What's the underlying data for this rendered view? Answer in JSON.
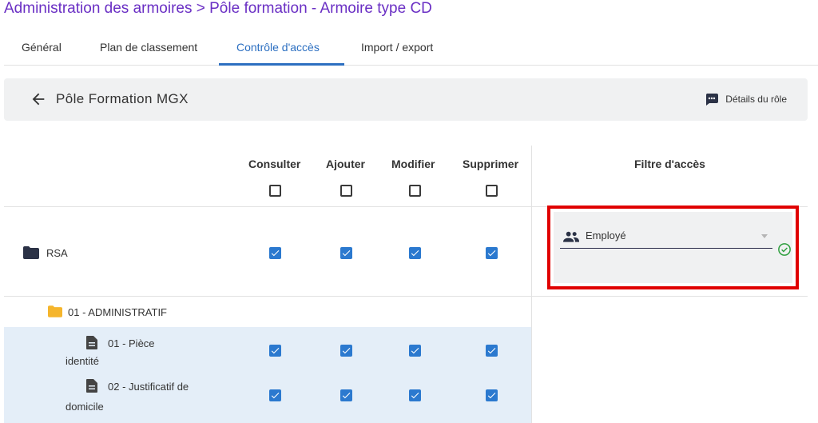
{
  "page": {
    "title": "Administration des armoires > Pôle formation - Armoire type CD"
  },
  "tabs": [
    {
      "label": "Général",
      "active": false
    },
    {
      "label": "Plan de classement",
      "active": false
    },
    {
      "label": "Contrôle d'accès",
      "active": true
    },
    {
      "label": "Import / export",
      "active": false
    }
  ],
  "role": {
    "name": "Pôle Formation MGX",
    "details_label": "Détails du rôle"
  },
  "table": {
    "columns": [
      "Consulter",
      "Ajouter",
      "Modifier",
      "Supprimer"
    ],
    "filter_column": "Filtre d'accès",
    "header_checks": [
      false,
      false,
      false,
      false
    ],
    "rows": [
      {
        "label": "RSA",
        "type": "folder-dark",
        "checks": [
          true,
          true,
          true,
          true
        ],
        "filter": "Employé"
      },
      {
        "label": "01 - ADMINISTRATIF",
        "type": "folder-yellow",
        "checks": null
      },
      {
        "label_line1": "01 - Pièce",
        "label_line2": "identité",
        "type": "document",
        "checks": [
          true,
          true,
          true,
          true
        ]
      },
      {
        "label_line1": "02 - Justificatif de",
        "label_line2": "domicile",
        "type": "document",
        "checks": [
          true,
          true,
          true,
          true
        ]
      }
    ]
  },
  "colors": {
    "title": "#6a2fc4",
    "active_tab": "#2c6fc1",
    "checkbox_on": "#2b79cf",
    "highlight_border": "#e00000",
    "ok_check": "#2e9e3e",
    "folder_yellow": "#f5b52c",
    "folder_dark": "#2b3246"
  },
  "icons": {
    "back": "arrow-left-icon",
    "details": "comment-dots-icon",
    "folder": "folder-icon",
    "document": "document-icon",
    "group": "group-icon",
    "ok": "check-circle-icon",
    "dropdown": "caret-down-icon"
  }
}
